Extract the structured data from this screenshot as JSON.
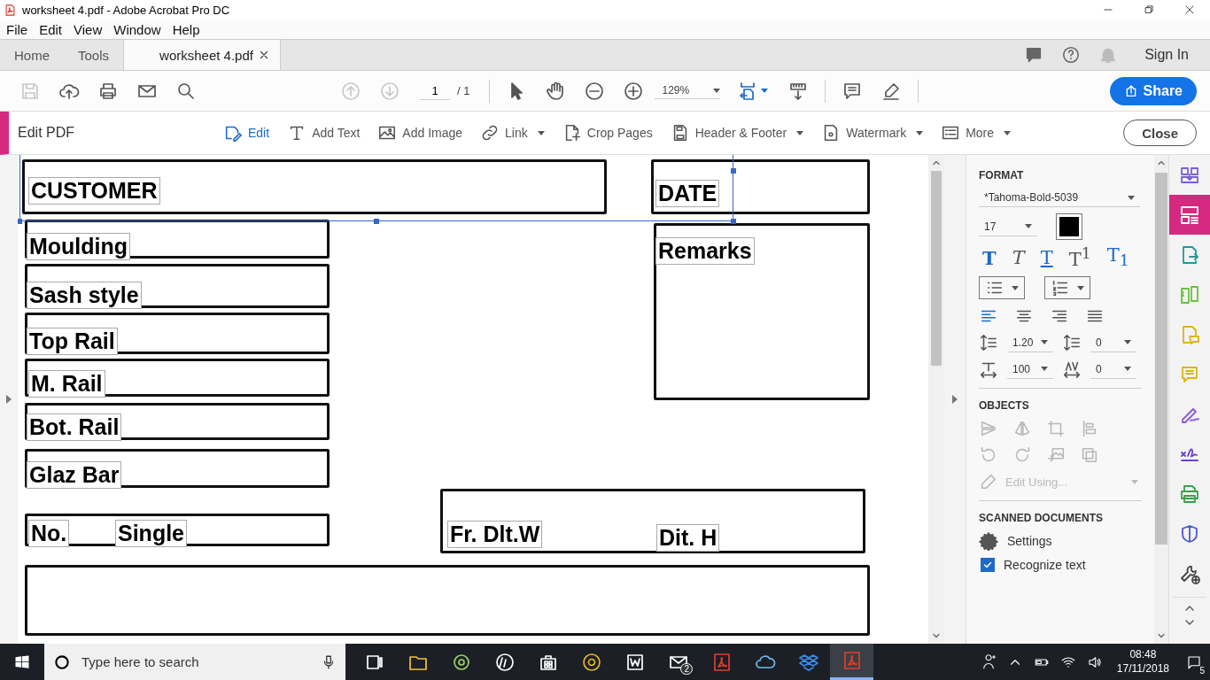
{
  "window": {
    "title": "worksheet 4.pdf - Adobe Acrobat Pro DC"
  },
  "menu": [
    "File",
    "Edit",
    "View",
    "Window",
    "Help"
  ],
  "tabs": [
    {
      "label": "Home",
      "selected": false,
      "closable": false
    },
    {
      "label": "Tools",
      "selected": false,
      "closable": false
    },
    {
      "label": "worksheet 4.pdf",
      "selected": true,
      "closable": true
    }
  ],
  "account": {
    "sign_in": "Sign In"
  },
  "toolbar": {
    "left_tools": [
      {
        "kind": "save",
        "disabled": true
      },
      {
        "kind": "upload",
        "disabled": false
      },
      {
        "kind": "print",
        "disabled": false
      },
      {
        "kind": "mail",
        "disabled": false
      },
      {
        "kind": "search",
        "disabled": false
      }
    ],
    "nav_tools": [
      {
        "kind": "up",
        "disabled": true
      },
      {
        "kind": "down",
        "disabled": true
      }
    ],
    "page": "1",
    "page_total": "/ 1",
    "view_tools": [
      {
        "kind": "pointer",
        "disabled": false
      },
      {
        "kind": "hand",
        "disabled": false
      },
      {
        "kind": "zoomout",
        "disabled": false
      },
      {
        "kind": "zoomin",
        "disabled": false
      }
    ],
    "zoom": "129%",
    "share": "Share"
  },
  "edit_bar": {
    "title": "Edit PDF",
    "tools": [
      {
        "label": "Edit",
        "kind": "edit",
        "selected": true,
        "dropdown": false
      },
      {
        "label": "Add Text",
        "kind": "addtext",
        "selected": false,
        "dropdown": false
      },
      {
        "label": "Add Image",
        "kind": "image",
        "selected": false,
        "dropdown": false
      },
      {
        "label": "Link",
        "kind": "link",
        "selected": false,
        "dropdown": true
      },
      {
        "label": "Crop Pages",
        "kind": "crop",
        "selected": false,
        "dropdown": false
      },
      {
        "label": "Header & Footer",
        "kind": "header",
        "selected": false,
        "dropdown": true
      },
      {
        "label": "Watermark",
        "kind": "watermark",
        "selected": false,
        "dropdown": true
      },
      {
        "label": "More",
        "kind": "more",
        "selected": false,
        "dropdown": true
      }
    ],
    "close": "Close"
  },
  "document": {
    "labels": [
      "CUSTOMER",
      "DATE",
      "Moulding",
      "Sash style",
      "Top Rail",
      "M. Rail",
      "Bot. Rail",
      "Glaz Bar",
      "No.",
      "Single",
      "Remarks",
      "Fr. Dlt.W",
      "Dit. H"
    ]
  },
  "format_panel": {
    "title": "FORMAT",
    "font": "*Tahoma-Bold-5039",
    "size": "17",
    "text_styles": [
      {
        "glyph": "T",
        "kind": "bold",
        "selected": true
      },
      {
        "glyph": "T",
        "kind": "italic",
        "selected": false
      },
      {
        "glyph": "T",
        "kind": "underline",
        "selected": true
      },
      {
        "glyph": "T$^{1}$",
        "kind": "super",
        "selected": false
      },
      {
        "glyph": "T$_{1}$",
        "kind": "sub",
        "selected": true
      }
    ],
    "alignments": [
      {
        "kind": "left",
        "selected": true
      },
      {
        "kind": "center",
        "selected": false
      },
      {
        "kind": "right",
        "selected": false
      },
      {
        "kind": "justify",
        "selected": false
      }
    ],
    "line_spacing": "1.20",
    "paragraph_spacing": "0",
    "horizontal_scaling": "100",
    "character_spacing": "0"
  },
  "objects_panel": {
    "title": "OBJECTS",
    "edit_using": "Edit Using...",
    "disabled": true
  },
  "scanned_panel": {
    "title": "SCANNED DOCUMENTS",
    "settings": "Settings",
    "recognize": {
      "label": "Recognize text",
      "checked": true
    }
  },
  "tool_strip": [
    {
      "kind": "combine",
      "color": "#7b5fd6",
      "selected": false
    },
    {
      "kind": "organize",
      "color": "#ffffff",
      "selected": true
    },
    {
      "kind": "export",
      "color": "#1e9b94",
      "selected": false
    },
    {
      "kind": "compare",
      "color": "#6ac23b",
      "selected": false
    },
    {
      "kind": "createpdf",
      "color": "#d7b619",
      "selected": false
    },
    {
      "kind": "comment",
      "color": "#d7b619",
      "selected": false
    },
    {
      "kind": "fillsign",
      "color": "#8b5bd6",
      "selected": false
    },
    {
      "kind": "sign",
      "color": "#6b3fd1",
      "selected": false
    },
    {
      "kind": "printprod",
      "color": "#3aa14a",
      "selected": false
    },
    {
      "kind": "protect",
      "color": "#4b58c9",
      "selected": false
    },
    {
      "kind": "moretools",
      "color": "#444444",
      "selected": false
    }
  ],
  "taskbar": {
    "search_placeholder": "Type here to search",
    "apps": [
      {
        "kind": "taskview",
        "active": false
      },
      {
        "kind": "folder",
        "active": false
      },
      {
        "kind": "camera",
        "active": false
      },
      {
        "kind": "hp",
        "active": false
      },
      {
        "kind": "store",
        "active": false
      },
      {
        "kind": "chrome",
        "active": false
      },
      {
        "kind": "word",
        "active": false
      },
      {
        "kind": "mail",
        "active": false,
        "badge": "2"
      },
      {
        "kind": "acrobat",
        "active": false
      },
      {
        "kind": "cloud",
        "active": false
      },
      {
        "kind": "dropbox",
        "active": false
      },
      {
        "kind": "acrobat",
        "active": true
      }
    ],
    "time": "08:48",
    "date": "17/11/2018",
    "notifications": "5"
  }
}
